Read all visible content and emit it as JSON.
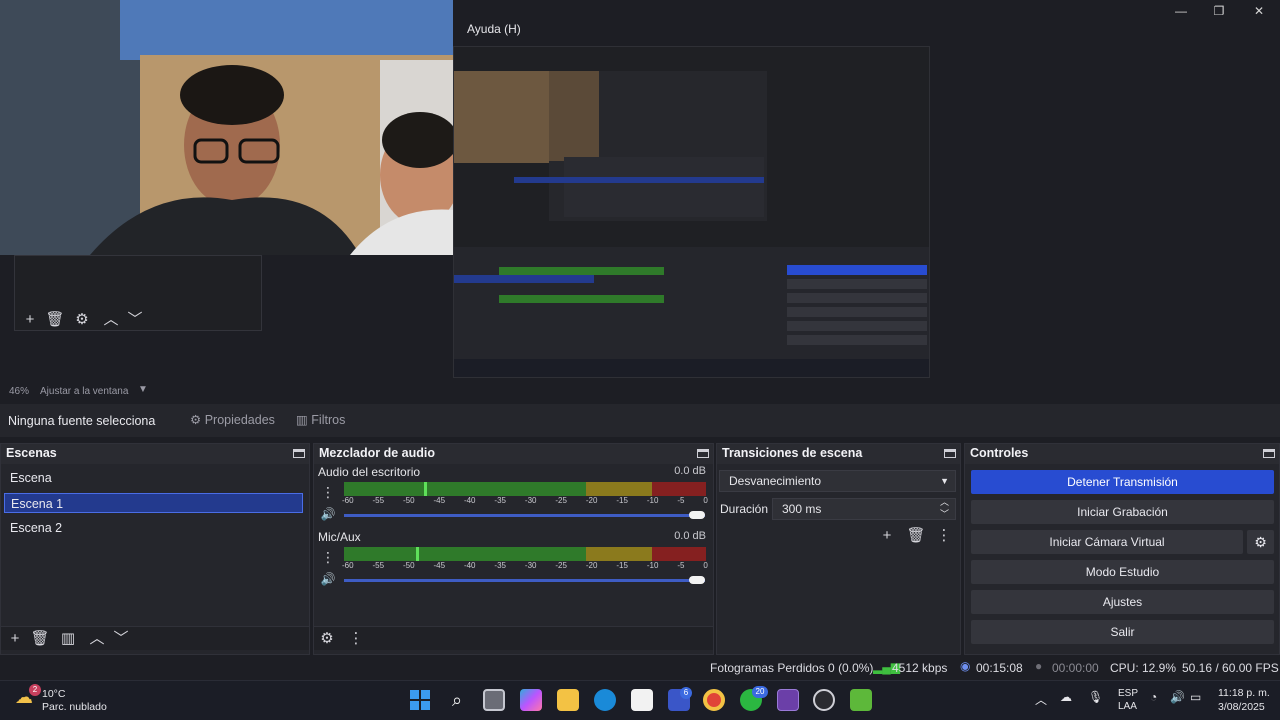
{
  "window": {
    "menu_help": "Ayuda (H)",
    "minimize": "—",
    "maximize": "❐",
    "close": "✕"
  },
  "zoom": {
    "level": "46%",
    "fit_label": "Ajustar a la ventana"
  },
  "source_bar": {
    "no_source": "Ninguna fuente selecciona",
    "properties": "Propiedades",
    "filters": "Filtros"
  },
  "scenes": {
    "title": "Escenas",
    "items": [
      "Escena",
      "Escena 1",
      "Escena 2"
    ],
    "selected_index": 1
  },
  "mixer": {
    "title": "Mezclador de audio",
    "channels": [
      {
        "name": "Audio del escritorio",
        "db": "0.0 dB",
        "level": 0.22
      },
      {
        "name": "Mic/Aux",
        "db": "0.0 dB",
        "level": 0.2
      }
    ],
    "scale": [
      "-60",
      "-55",
      "-50",
      "-45",
      "-40",
      "-35",
      "-30",
      "-25",
      "-20",
      "-15",
      "-10",
      "-5",
      "0"
    ]
  },
  "transitions": {
    "title": "Transiciones de escena",
    "type": "Desvanecimiento",
    "duration_label": "Duración",
    "duration_value": "300 ms"
  },
  "controls": {
    "title": "Controles",
    "stop_stream": "Detener Transmisión",
    "start_recording": "Iniciar Grabación",
    "start_virtual_cam": "Iniciar Cámara Virtual",
    "studio_mode": "Modo Estudio",
    "settings": "Ajustes",
    "exit": "Salir"
  },
  "status": {
    "dropped_frames": "Fotogramas Perdidos 0 (0.0%)",
    "bitrate": "4512 kbps",
    "stream_time": "00:15:08",
    "rec_time": "00:00:00",
    "cpu": "CPU: 12.9%",
    "fps": "50.16 / 60.00 FPS"
  },
  "taskbar": {
    "weather_temp": "10°C",
    "weather_desc": "Parc. nublado",
    "weather_badge": "2",
    "lang": "ESP",
    "region": "LAA",
    "time": "11:18 p. m.",
    "date": "3/08/2025",
    "badge_teams": "6",
    "badge_whatsapp": "20"
  },
  "colors": {
    "accent": "#284cd1",
    "selection": "#233a8e",
    "meter_green": "#2f7a2a",
    "meter_yellow": "#8b7a1d",
    "meter_red": "#852020"
  }
}
